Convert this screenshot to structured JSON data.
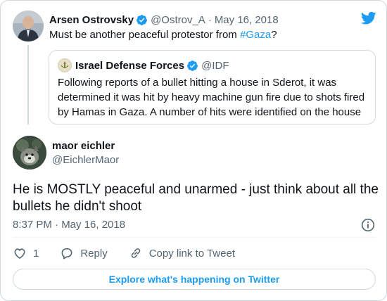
{
  "parent_tweet": {
    "name": "Arsen Ostrovsky",
    "handle": "@Ostrov_A",
    "separator": "·",
    "date": "May 16, 2018",
    "text_prefix": "Must be another peaceful protestor from ",
    "hashtag": "#Gaza",
    "text_suffix": "?"
  },
  "quoted_tweet": {
    "name": "Israel Defense Forces",
    "handle": "@IDF",
    "text": "Following reports of a bullet hitting a house in Sderot, it was determined it was hit by heavy machine gun fire due to shots fired by Hamas in Gaza. A number of hits were identified on the house"
  },
  "main_tweet": {
    "name": "maor eichler",
    "handle": "@EichlerMaor",
    "text": "He is MOSTLY peaceful and unarmed - just think about all the bullets he didn't shoot",
    "timestamp": "8:37 PM · May 16, 2018"
  },
  "actions": {
    "like_count": "1",
    "reply_label": "Reply",
    "copy_link_label": "Copy link to Tweet"
  },
  "explore_label": "Explore what's happening on Twitter",
  "colors": {
    "accent": "#1d9bf0",
    "text": "#0f1419",
    "secondary": "#536471",
    "border": "#cfd9de"
  }
}
